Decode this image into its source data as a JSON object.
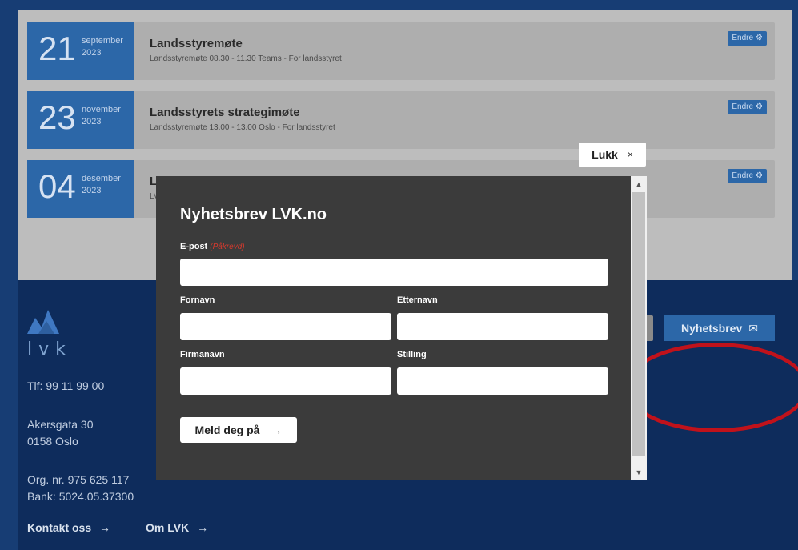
{
  "events": [
    {
      "day": "21",
      "month": "september",
      "year": "2023",
      "title": "Landsstyremøte",
      "subtitle": "Landsstyremøte 08.30 - 11.30 Teams - For landsstyret",
      "edit_label": "Endre"
    },
    {
      "day": "23",
      "month": "november",
      "year": "2023",
      "title": "Landsstyrets strategimøte",
      "subtitle": "Landsstyremøte 13.00 - 13.00 Oslo - For landsstyret",
      "edit_label": "Endre"
    },
    {
      "day": "04",
      "month": "desember",
      "year": "2023",
      "title": "L",
      "subtitle": "LV",
      "edit_label": "Endre"
    }
  ],
  "footer": {
    "logo_text": "lvk",
    "phone": "Tlf: 99 11 99 00",
    "address_line1": "Akersgata 30",
    "address_line2": "0158 Oslo",
    "org_nr": "Org. nr. 975 625 117",
    "bank": "Bank: 5024.05.37300",
    "link_contact": "Kontakt oss",
    "link_about": "Om LVK",
    "newsletter_button": "Nyhetsbrev"
  },
  "modal": {
    "close_label": "Lukk",
    "close_icon": "×",
    "title": "Nyhetsbrev LVK.no",
    "email_label": "E-post",
    "required_label": "(Påkrevd)",
    "firstname_label": "Fornavn",
    "lastname_label": "Etternavn",
    "company_label": "Firmanavn",
    "position_label": "Stilling",
    "email_value": "",
    "firstname_value": "",
    "lastname_value": "",
    "company_value": "",
    "position_value": "",
    "submit_label": "Meld deg på"
  },
  "icons": {
    "arrow_right": "→",
    "gear": "⚙",
    "envelope": "✉",
    "scroll_up": "▲",
    "scroll_down": "▼"
  },
  "colors": {
    "brand_blue": "#2c67a8",
    "footer_navy": "#0e2c5c",
    "annotation_red": "#c0121b"
  }
}
